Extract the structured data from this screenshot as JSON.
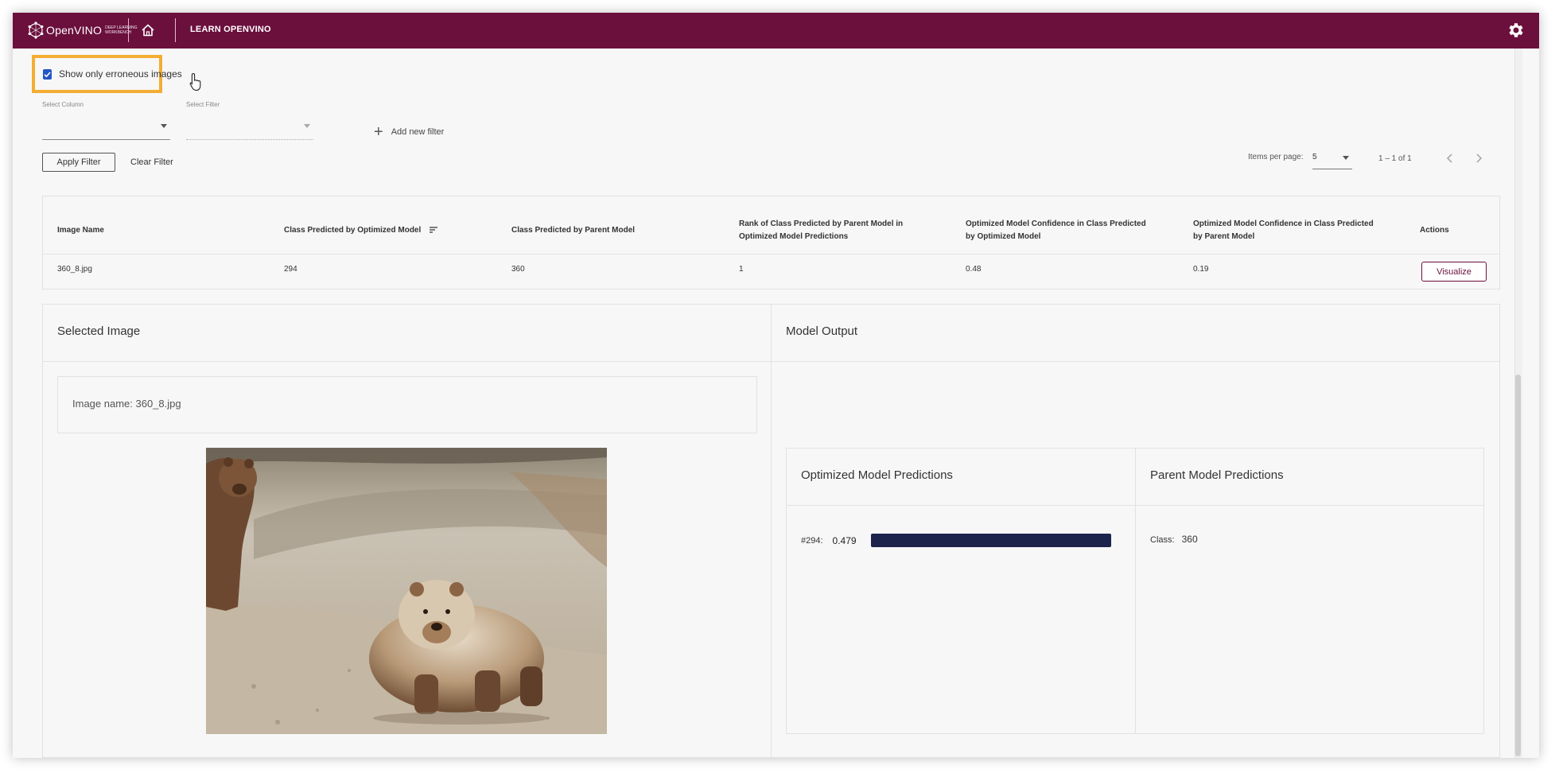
{
  "header": {
    "logo_text": "OpenVINO",
    "logo_sub": "DEEP LEARNING WORKBENCH",
    "learn_label": "LEARN OPENVINO"
  },
  "filters": {
    "erroneous_label": "Show only erroneous images",
    "erroneous_checked": true,
    "select_column_label": "Select Column",
    "select_filter_label": "Select Filter",
    "add_filter_label": "Add new filter",
    "apply_label": "Apply Filter",
    "clear_label": "Clear Filter"
  },
  "pagination": {
    "items_per_page_label": "Items per page:",
    "items_per_page_value": "5",
    "range_label": "1 – 1 of 1"
  },
  "table": {
    "headers": [
      "Image Name",
      "Class Predicted by Optimized Model",
      "Class Predicted by Parent Model",
      "Rank of Class Predicted by Parent Model in Optimized Model Predictions",
      "Optimized Model Confidence in Class Predicted by Optimized Model",
      "Optimized Model Confidence in Class Predicted by Parent Model",
      "Actions"
    ],
    "rows": [
      [
        "360_8.jpg",
        "294",
        "360",
        "1",
        "0.48",
        "0.19"
      ]
    ],
    "action_label": "Visualize"
  },
  "selected_image": {
    "title": "Selected Image",
    "image_name": "Image name: 360_8.jpg"
  },
  "model_output": {
    "title": "Model Output",
    "optimized_title": "Optimized Model Predictions",
    "parent_title": "Parent Model Predictions",
    "optimized_predictions": [
      {
        "class_label": "#294:",
        "value": "0.479",
        "fraction": 0.479
      }
    ],
    "parent_class_label": "Class:",
    "parent_class_value": "360"
  },
  "colors": {
    "brand": "#6b0f3d",
    "highlight": "#f4ad32",
    "checkbox": "#2455c6",
    "bar": "#1c244c"
  },
  "icons": [
    "openvino-logo-icon",
    "home-icon",
    "gear-icon",
    "checkbox-check-icon",
    "pointer-cursor-icon",
    "dropdown-caret-icon",
    "plus-icon",
    "sort-icon",
    "chevron-left-icon",
    "chevron-right-icon"
  ]
}
